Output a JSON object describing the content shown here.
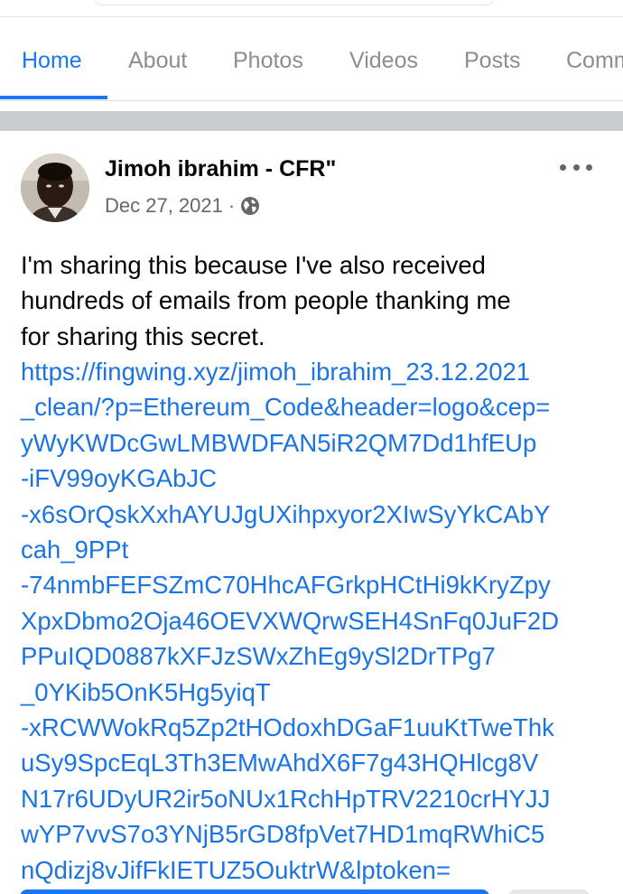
{
  "tabs": [
    {
      "label": "Home",
      "active": true
    },
    {
      "label": "About",
      "active": false
    },
    {
      "label": "Photos",
      "active": false
    },
    {
      "label": "Videos",
      "active": false
    },
    {
      "label": "Posts",
      "active": false
    },
    {
      "label": "Comm",
      "active": false
    }
  ],
  "post": {
    "author": "Jimoh ibrahim - CFR\"",
    "date": "Dec 27, 2021",
    "separator": "·",
    "audience_icon": "globe-icon",
    "text_lines": [
      "I'm sharing this because I've also received",
      "hundreds of emails from people thanking me",
      "for sharing this secret."
    ],
    "link_lines": [
      "https://fingwing.xyz/jimoh_ibrahim_23.12.2021",
      "_clean/?p=Ethereum_Code&header=logo&cep=",
      "yWyKWDcGwLMBWDFAN5iR2QM7Dd1hfEUp",
      "-iFV99oyKGAbJC",
      "-x6sOrQskXxhAYUJgUXihpxyor2XIwSyYkCAbY",
      "cah_9PPt",
      "-74nmbFEFSZmC70HhcAFGrkpHCtHi9kKryZpy",
      "XpxDbmo2Oja46OEVXWQrwSEH4SnFq0JuF2D",
      "PPuIQD0887kXFJzSWxZhEg9ySl2DrTPg7",
      "_0YKib5OnK5Hg5yiqT",
      "-xRCWWokRq5Zp2tHOdoxhDGaF1uuKtTweThk",
      "uSy9SpcEqL3Th3EMwAhdX6F7g43HQHlcg8V",
      "N17r6UDyUR2ir5oNUx1RchHpTRV2210crHYJJ",
      "wYP7vvS7o3YNjB5rGD8fpVet7HD1mqRWhiC5",
      "nQdizj8vJifFkIETUZ5OuktrW&lptoken="
    ]
  },
  "colors": {
    "accent": "#1877f2",
    "link": "#1b74e4",
    "muted": "#65676b"
  }
}
